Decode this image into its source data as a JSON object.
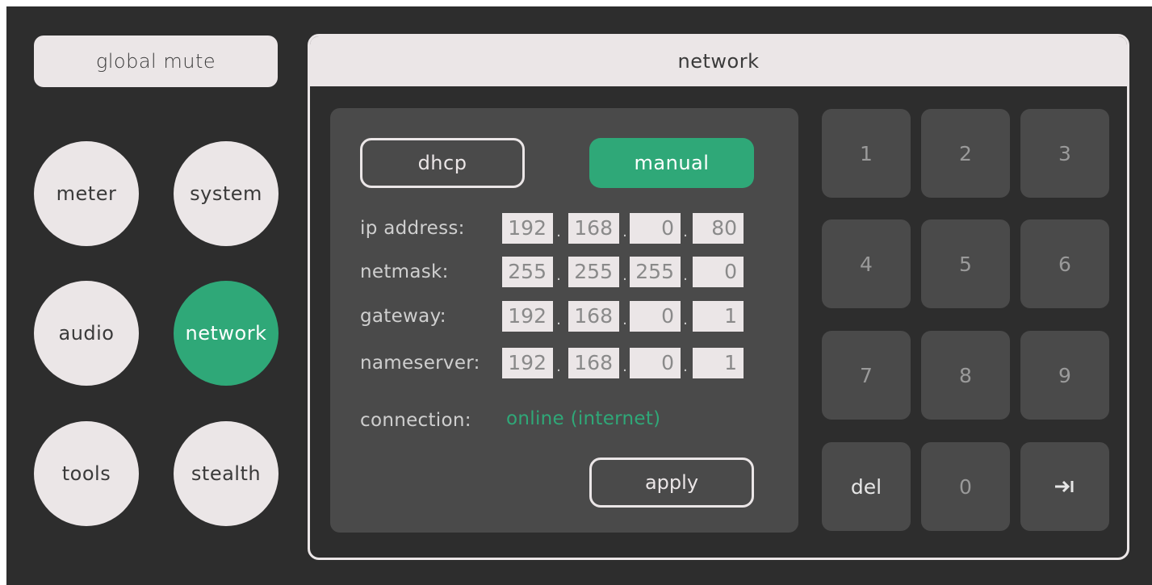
{
  "sidebar": {
    "global_mute": "global mute",
    "buttons": [
      "meter",
      "system",
      "audio",
      "network",
      "tools",
      "stealth"
    ]
  },
  "network": {
    "title": "network",
    "modes": {
      "dhcp": "dhcp",
      "manual": "manual"
    },
    "fields": [
      {
        "label": "ip address:",
        "octets": [
          "192",
          "168",
          "0",
          "80"
        ]
      },
      {
        "label": "netmask:",
        "octets": [
          "255",
          "255",
          "255",
          "0"
        ]
      },
      {
        "label": "gateway:",
        "octets": [
          "192",
          "168",
          "0",
          "1"
        ]
      },
      {
        "label": "nameserver:",
        "octets": [
          "192",
          "168",
          "0",
          "1"
        ]
      }
    ],
    "connection_label": "connection:",
    "connection_value": "online (internet)",
    "apply_label": "apply"
  },
  "keypad": {
    "keys": [
      "1",
      "2",
      "3",
      "4",
      "5",
      "6",
      "7",
      "8",
      "9",
      "del",
      "0"
    ],
    "tab_icon": "tab-arrow-icon"
  },
  "colors": {
    "accent": "#2fa878",
    "background": "#2d2d2d",
    "panel": "#4a4a4a",
    "light": "#ebe6e7"
  }
}
